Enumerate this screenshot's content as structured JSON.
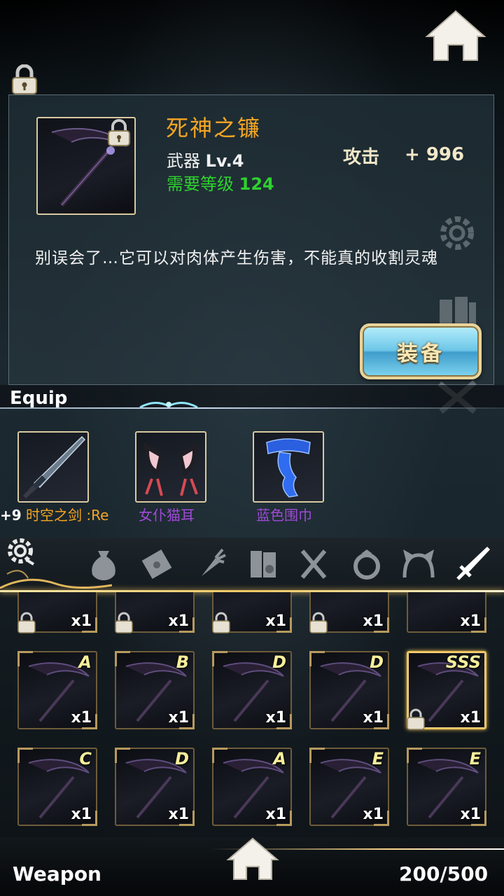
{
  "item": {
    "name": "死神之镰",
    "type_label": "武器",
    "level_label": "Lv.4",
    "req_label": "需要等级",
    "req_value": "124",
    "stat_label": "攻击",
    "stat_value": "+ 996",
    "description": "别误会了…它可以对肉体产生伤害，不能真的收割灵魂",
    "equip_button": "装备"
  },
  "equip_section": {
    "title": "Equip",
    "slots": [
      {
        "prefix": "+9",
        "name": "时空之剑 :Re",
        "color": "#f5a623"
      },
      {
        "prefix": "",
        "name": "女仆猫耳",
        "color": "#a04ad8"
      },
      {
        "prefix": "",
        "name": "蓝色围巾",
        "color": "#a04ad8"
      }
    ]
  },
  "tabs": [
    "bag-icon",
    "scroll-icon",
    "carrot-icon",
    "books-icon",
    "utensils-icon",
    "ring-icon",
    "headband-icon",
    "sword-icon"
  ],
  "grid": {
    "top_row": [
      {
        "qty": "x1",
        "locked": true
      },
      {
        "qty": "x1",
        "locked": true
      },
      {
        "qty": "x1",
        "locked": true
      },
      {
        "qty": "x1",
        "locked": true
      },
      {
        "qty": "x1",
        "locked": false
      }
    ],
    "row2": [
      {
        "grade": "A",
        "qty": "x1"
      },
      {
        "grade": "B",
        "qty": "x1"
      },
      {
        "grade": "D",
        "qty": "x1"
      },
      {
        "grade": "D",
        "qty": "x1"
      },
      {
        "grade": "SSS",
        "qty": "x1",
        "selected": true,
        "locked": true
      }
    ],
    "row3": [
      {
        "grade": "C",
        "qty": "x1"
      },
      {
        "grade": "D",
        "qty": "x1"
      },
      {
        "grade": "A",
        "qty": "x1"
      },
      {
        "grade": "E",
        "qty": "x1"
      },
      {
        "grade": "E",
        "qty": "x1"
      }
    ]
  },
  "footer": {
    "category": "Weapon",
    "capacity": "200/500"
  },
  "colors": {
    "item_name": "#f5a623",
    "req_level": "#2ed12e",
    "rare_name": "#a04ad8",
    "accent_gold": "#f2c25a"
  }
}
